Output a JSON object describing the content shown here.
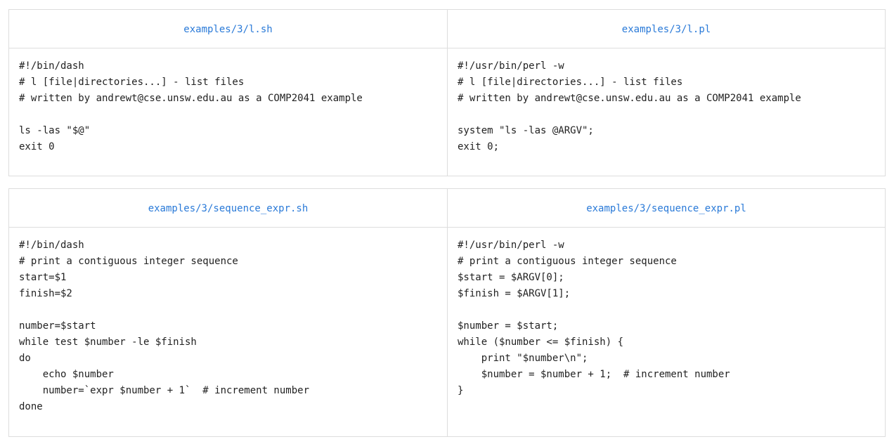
{
  "pairs": [
    {
      "left": {
        "filename": "examples/3/l.sh",
        "code": "#!/bin/dash\n# l [file|directories...] - list files\n# written by andrewt@cse.unsw.edu.au as a COMP2041 example\n\nls -las \"$@\"\nexit 0"
      },
      "right": {
        "filename": "examples/3/l.pl",
        "code": "#!/usr/bin/perl -w\n# l [file|directories...] - list files\n# written by andrewt@cse.unsw.edu.au as a COMP2041 example\n\nsystem \"ls -las @ARGV\";\nexit 0;"
      }
    },
    {
      "left": {
        "filename": "examples/3/sequence_expr.sh",
        "code": "#!/bin/dash\n# print a contiguous integer sequence\nstart=$1\nfinish=$2\n\nnumber=$start\nwhile test $number -le $finish\ndo\n    echo $number\n    number=`expr $number + 1`  # increment number\ndone"
      },
      "right": {
        "filename": "examples/3/sequence_expr.pl",
        "code": "#!/usr/bin/perl -w\n# print a contiguous integer sequence\n$start = $ARGV[0];\n$finish = $ARGV[1];\n\n$number = $start;\nwhile ($number <= $finish) {\n    print \"$number\\n\";\n    $number = $number + 1;  # increment number\n}"
      }
    }
  ],
  "colors": {
    "link": "#2a7ad8",
    "border": "#dddddd",
    "text": "#222222"
  }
}
